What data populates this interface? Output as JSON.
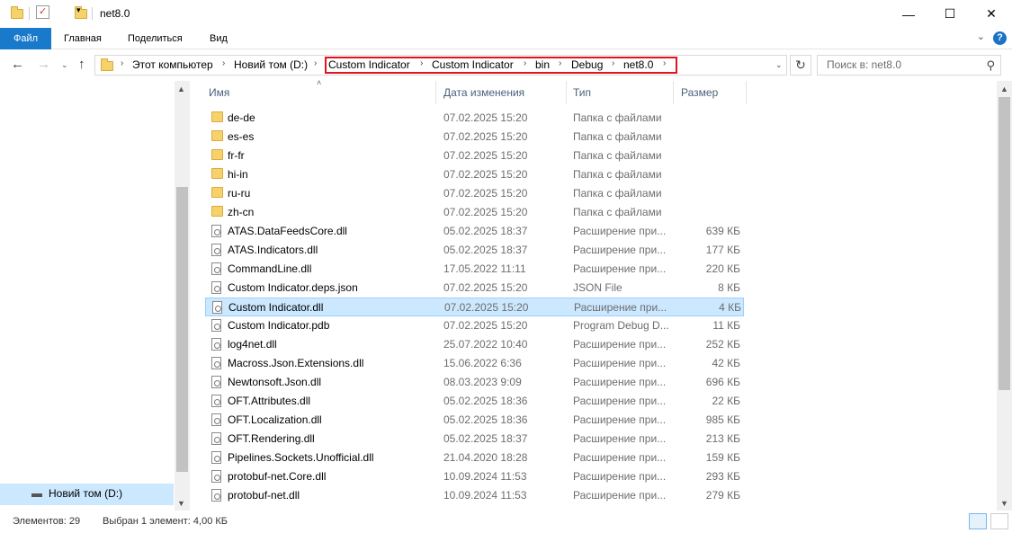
{
  "window": {
    "title": "net8.0"
  },
  "ribbon": {
    "tabs": [
      "Файл",
      "Главная",
      "Поделиться",
      "Вид"
    ],
    "help": "?"
  },
  "address": {
    "root": "Этот компьютер",
    "drive": "Новий том (D:)",
    "highlighted": [
      "Custom Indicator",
      "Custom Indicator",
      "bin",
      "Debug",
      "net8.0"
    ]
  },
  "search": {
    "placeholder": "Поиск в: net8.0"
  },
  "columns": {
    "name": "Имя",
    "date": "Дата изменения",
    "type": "Тип",
    "size": "Размер"
  },
  "nav": {
    "selected": "Новий том (D:)"
  },
  "files": [
    {
      "name": "de-de",
      "date": "07.02.2025 15:20",
      "type": "Папка с файлами",
      "size": "",
      "icon": "folder-icon"
    },
    {
      "name": "es-es",
      "date": "07.02.2025 15:20",
      "type": "Папка с файлами",
      "size": "",
      "icon": "folder-icon"
    },
    {
      "name": "fr-fr",
      "date": "07.02.2025 15:20",
      "type": "Папка с файлами",
      "size": "",
      "icon": "folder-icon"
    },
    {
      "name": "hi-in",
      "date": "07.02.2025 15:20",
      "type": "Папка с файлами",
      "size": "",
      "icon": "folder-icon"
    },
    {
      "name": "ru-ru",
      "date": "07.02.2025 15:20",
      "type": "Папка с файлами",
      "size": "",
      "icon": "folder-icon"
    },
    {
      "name": "zh-cn",
      "date": "07.02.2025 15:20",
      "type": "Папка с файлами",
      "size": "",
      "icon": "folder-icon"
    },
    {
      "name": "ATAS.DataFeedsCore.dll",
      "date": "05.02.2025 18:37",
      "type": "Расширение при...",
      "size": "639 КБ",
      "icon": "dll-icon"
    },
    {
      "name": "ATAS.Indicators.dll",
      "date": "05.02.2025 18:37",
      "type": "Расширение при...",
      "size": "177 КБ",
      "icon": "dll-icon"
    },
    {
      "name": "CommandLine.dll",
      "date": "17.05.2022 11:11",
      "type": "Расширение при...",
      "size": "220 КБ",
      "icon": "dll-icon"
    },
    {
      "name": "Custom Indicator.deps.json",
      "date": "07.02.2025 15:20",
      "type": "JSON File",
      "size": "8 КБ",
      "icon": "json-icon"
    },
    {
      "name": "Custom Indicator.dll",
      "date": "07.02.2025 15:20",
      "type": "Расширение при...",
      "size": "4 КБ",
      "icon": "dll-icon",
      "selected": true
    },
    {
      "name": "Custom Indicator.pdb",
      "date": "07.02.2025 15:20",
      "type": "Program Debug D...",
      "size": "11 КБ",
      "icon": "pdb-icon"
    },
    {
      "name": "log4net.dll",
      "date": "25.07.2022 10:40",
      "type": "Расширение при...",
      "size": "252 КБ",
      "icon": "dll-icon"
    },
    {
      "name": "Macross.Json.Extensions.dll",
      "date": "15.06.2022 6:36",
      "type": "Расширение при...",
      "size": "42 КБ",
      "icon": "dll-icon"
    },
    {
      "name": "Newtonsoft.Json.dll",
      "date": "08.03.2023 9:09",
      "type": "Расширение при...",
      "size": "696 КБ",
      "icon": "dll-icon"
    },
    {
      "name": "OFT.Attributes.dll",
      "date": "05.02.2025 18:36",
      "type": "Расширение при...",
      "size": "22 КБ",
      "icon": "dll-icon"
    },
    {
      "name": "OFT.Localization.dll",
      "date": "05.02.2025 18:36",
      "type": "Расширение при...",
      "size": "985 КБ",
      "icon": "dll-icon"
    },
    {
      "name": "OFT.Rendering.dll",
      "date": "05.02.2025 18:37",
      "type": "Расширение при...",
      "size": "213 КБ",
      "icon": "dll-icon"
    },
    {
      "name": "Pipelines.Sockets.Unofficial.dll",
      "date": "21.04.2020 18:28",
      "type": "Расширение при...",
      "size": "159 КБ",
      "icon": "dll-icon"
    },
    {
      "name": "protobuf-net.Core.dll",
      "date": "10.09.2024 11:53",
      "type": "Расширение при...",
      "size": "293 КБ",
      "icon": "dll-icon"
    },
    {
      "name": "protobuf-net.dll",
      "date": "10.09.2024 11:53",
      "type": "Расширение при...",
      "size": "279 КБ",
      "icon": "dll-icon"
    }
  ],
  "status": {
    "count": "Элементов: 29",
    "selection": "Выбран 1 элемент: 4,00 КБ"
  },
  "colors": {
    "accent": "#1979ca",
    "selection": "#cce8ff",
    "highlight_border": "#e0141e"
  }
}
